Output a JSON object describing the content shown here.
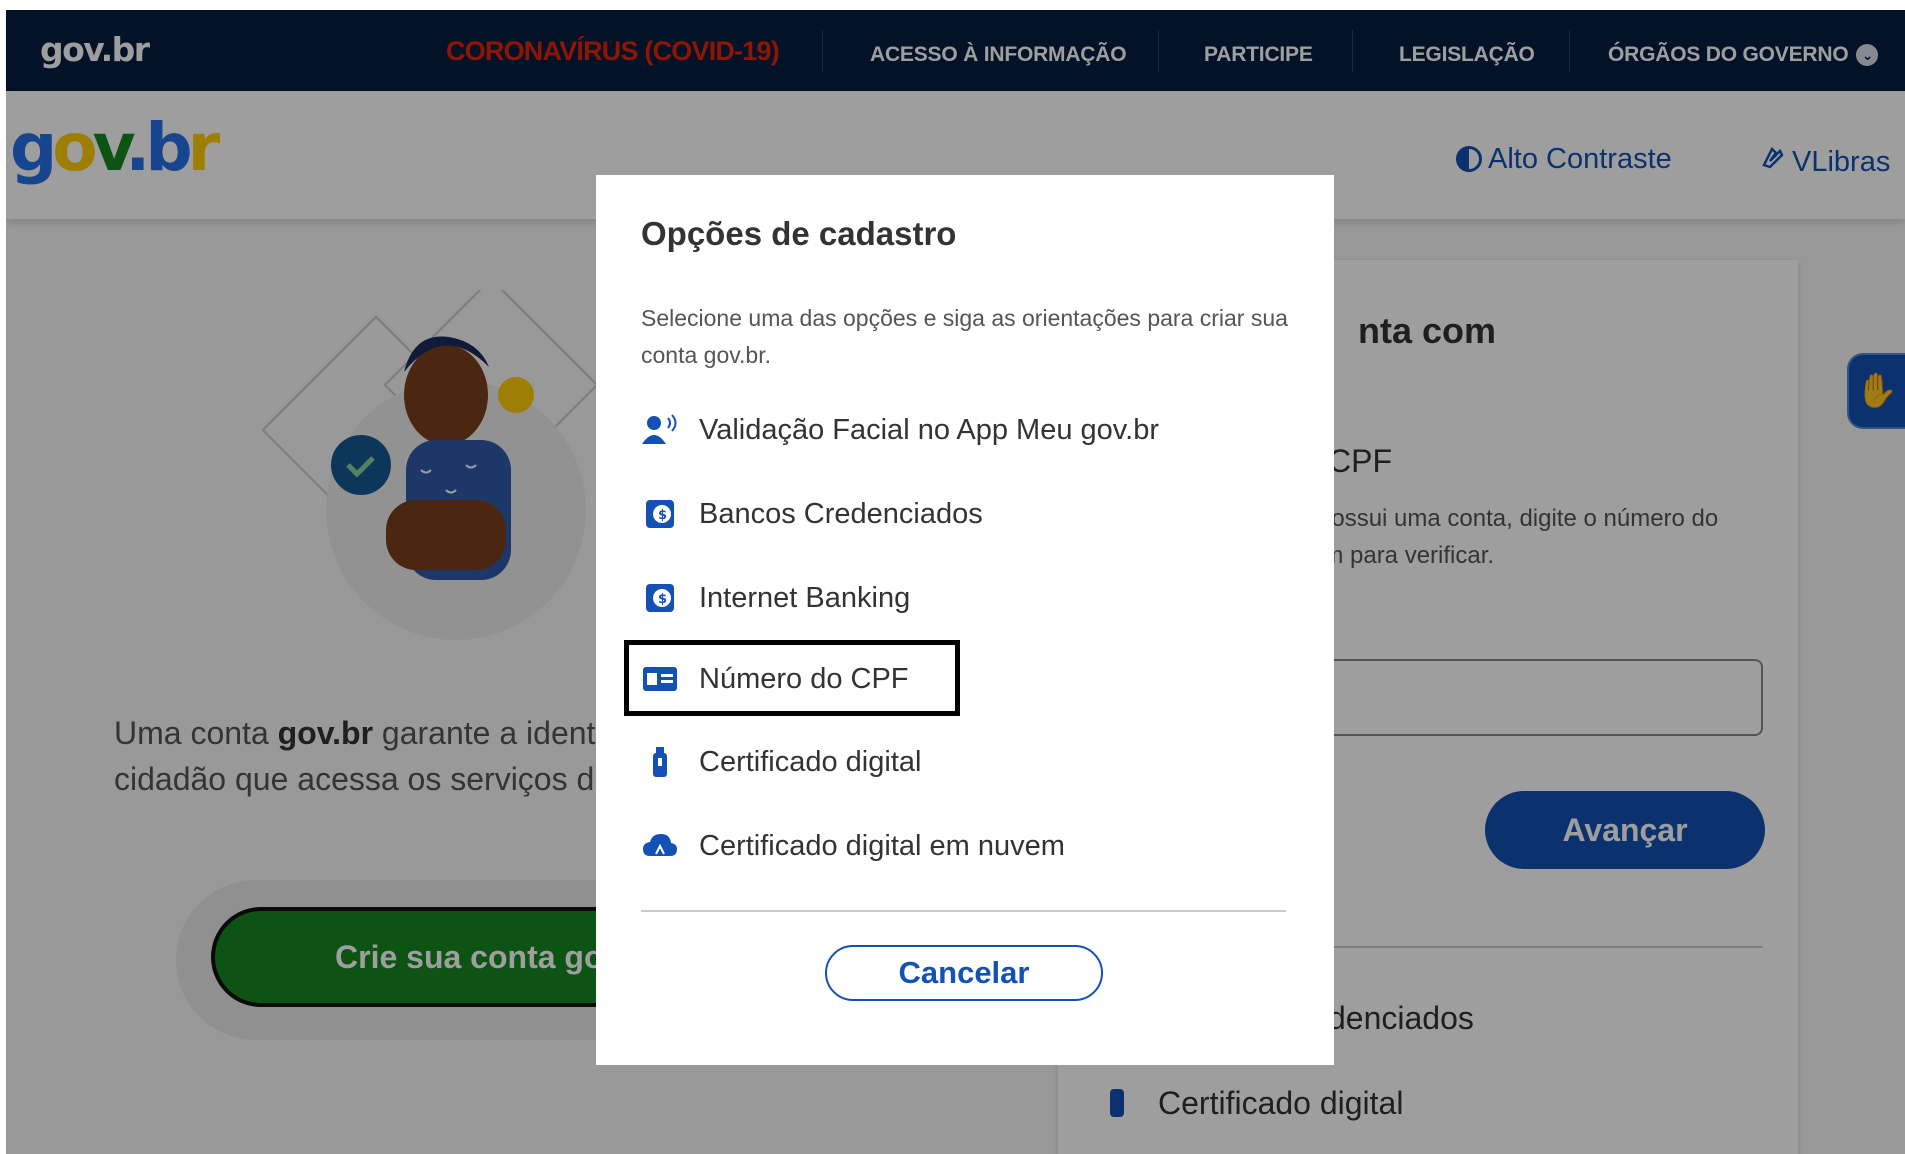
{
  "topbar": {
    "logo": "gov.br",
    "covid_link": "CORONAVÍRUS (COVID-19)",
    "links": [
      "ACESSO À INFORMAÇÃO",
      "PARTICIPE",
      "LEGISLAÇÃO",
      "ÓRGÃOS DO GOVERNO"
    ]
  },
  "header": {
    "logo": "gov.br",
    "contrast_label": "Alto Contraste",
    "vlibras_label": "VLibras"
  },
  "left": {
    "text_pre": "Uma conta ",
    "text_bold": "gov.br",
    "text_post": " garante a ident",
    "text_line2": "cidadão que acessa os serviços d",
    "create_button": "Crie sua conta go"
  },
  "card": {
    "title": "nta com",
    "cpf_label": "CPF",
    "desc_line1": "possui uma conta, digite o número do",
    "desc_line2": "im para verificar.",
    "advance_button": "Avançar",
    "list_item1": "denciados",
    "list_item2": "Certificado digital"
  },
  "modal": {
    "title": "Opções de cadastro",
    "description": "Selecione uma das opções e siga as orientações para criar sua conta gov.br.",
    "options": [
      {
        "label": "Validação Facial no App Meu gov.br",
        "icon": "face-id-icon"
      },
      {
        "label": "Bancos Credenciados",
        "icon": "bank-icon"
      },
      {
        "label": "Internet Banking",
        "icon": "bank-icon"
      },
      {
        "label": "Número do CPF",
        "icon": "id-card-icon"
      },
      {
        "label": "Certificado digital",
        "icon": "usb-token-icon"
      },
      {
        "label": "Certificado digital em nuvem",
        "icon": "cloud-certificate-icon"
      }
    ],
    "cancel_button": "Cancelar"
  },
  "colors": {
    "navy": "#071d41",
    "primary": "#1351b4",
    "covid_red": "#e52207",
    "green": "#168821",
    "yellow": "#ffcd07"
  }
}
